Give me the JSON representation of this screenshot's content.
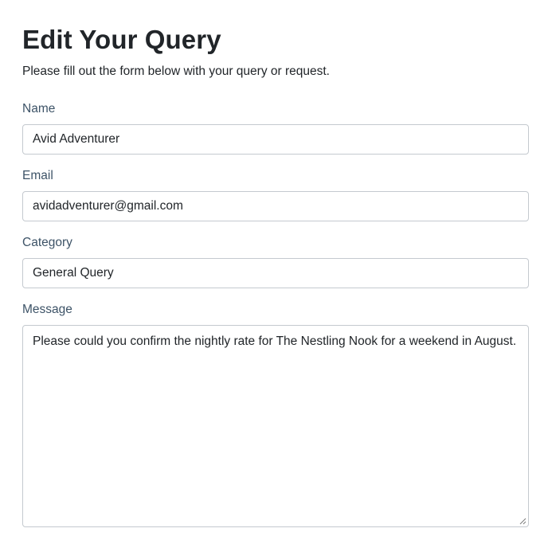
{
  "page": {
    "title": "Edit Your Query",
    "subtitle": "Please fill out the form below with your query or request."
  },
  "form": {
    "name": {
      "label": "Name",
      "value": "Avid Adventurer"
    },
    "email": {
      "label": "Email",
      "value": "avidadventurer@gmail.com"
    },
    "category": {
      "label": "Category",
      "value": "General Query"
    },
    "message": {
      "label": "Message",
      "value": "Please could you confirm the nightly rate for The Nestling Nook for a weekend in August."
    }
  },
  "icons": {
    "resize": "resize-grip-icon"
  },
  "colors": {
    "label": "#3d5367",
    "border": "#c4c9cf",
    "text": "#212529"
  }
}
